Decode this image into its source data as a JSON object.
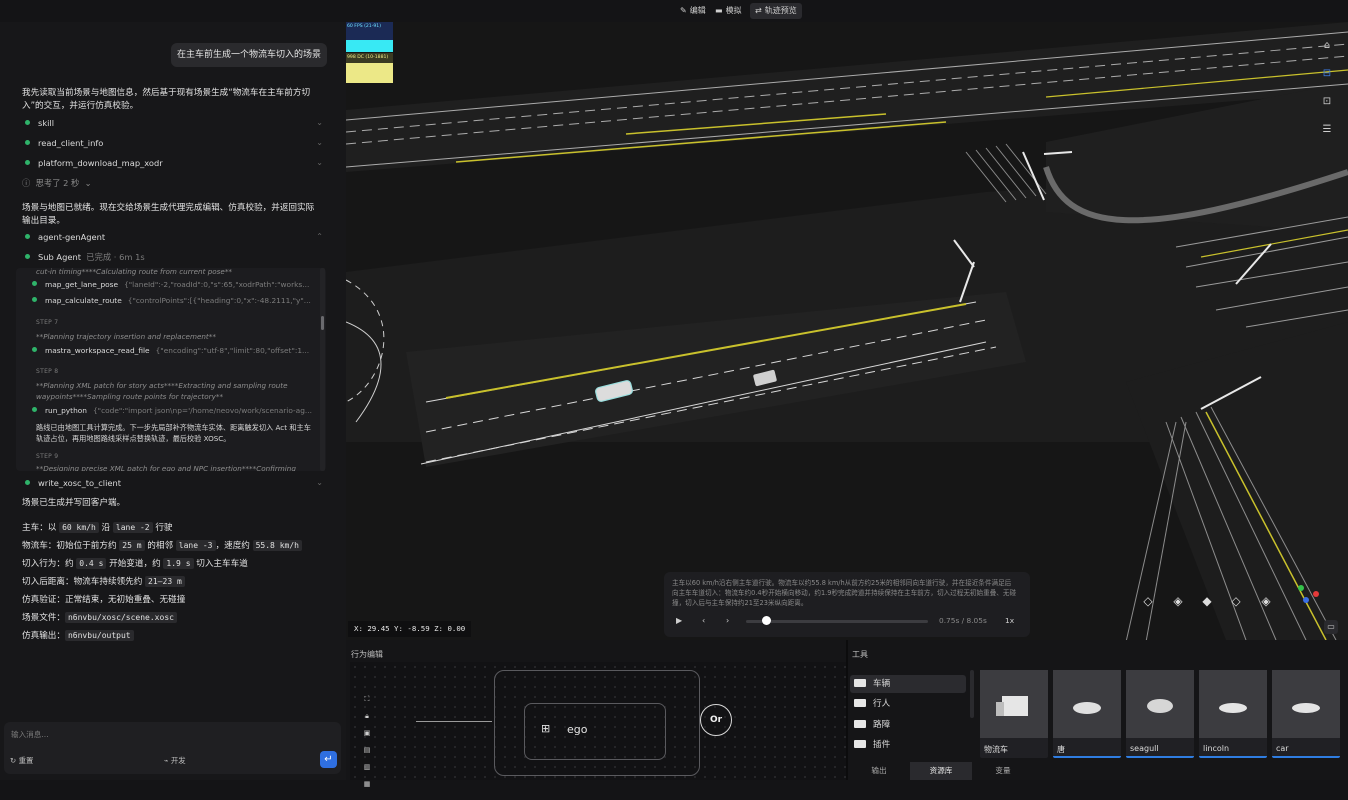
{
  "toolbar": {
    "items": [
      {
        "label": "编辑",
        "icon": "pencil-icon"
      },
      {
        "label": "模拟",
        "icon": "car-icon"
      },
      {
        "label": "轨迹预览",
        "icon": "trajectory-icon"
      }
    ]
  },
  "chat": {
    "user_message": "在主车前生成一个物流车切入的场景",
    "intro": "我先读取当前场景与地图信息，然后基于现有场景生成“物流车在主车前方切入”的交互，并运行仿真校验。",
    "tools_1": [
      "skill",
      "read_client_info",
      "platform_download_map_xodr"
    ],
    "thought": "思考了 2 秒",
    "ready_text": "场景与地图已就绪。现在交给场景生成代理完成编辑、仿真校验，并返回实际输出目录。",
    "agent_label": "agent-genAgent",
    "sub_agent": {
      "label": "Sub Agent",
      "status": "已完成 · 6m 1s"
    },
    "sub_panel": {
      "top_snippet": "cut-in timing****Calculating route from current pose**",
      "calls_1": [
        {
          "name": "map_get_lane_pose",
          "args": "{\"laneId\":-2,\"roadId\":0,\"s\":65,\"xodrPath\":\"works..."
        },
        {
          "name": "map_calculate_route",
          "args": "{\"controlPoints\":[{\"heading\":0,\"x\":-48.2111,\"y\"..."
        }
      ],
      "step7": "STEP 7",
      "step7_text": "**Planning trajectory insertion and replacement**",
      "call_7": {
        "name": "mastra_workspace_read_file",
        "args": "{\"encoding\":\"utf-8\",\"limit\":80,\"offset\":1..."
      },
      "step8": "STEP 8",
      "step8_text": "**Planning XML patch for story acts****Extracting and sampling route waypoints****Sampling route points for trajectory**",
      "call_8": {
        "name": "run_python",
        "args": "{\"code\":\"import json\\np='/home/neovo/work/scenario-ag..."
      },
      "note": "路线已由地图工具计算完成。下一步先局部补齐物流车实体、距离触发切入 Act 和主车轨迹占位，再用地图路线采样点替换轨迹，最后校验 XOSC。",
      "step9": "STEP 9",
      "step9_text": "**Designing precise XML patch for ego and NPC insertion****Confirming lane"
    },
    "write_tool": "write_xosc_to_client",
    "written": "场景已生成并写回客户端。",
    "summary": [
      {
        "label": "主车：以 ",
        "parts": [
          {
            "code": "60 km/h"
          },
          {
            "text": " 沿 "
          },
          {
            "code": "lane -2"
          },
          {
            "text": " 行驶"
          }
        ]
      },
      {
        "label": "物流车：初始位于前方约 ",
        "parts": [
          {
            "code": "25 m"
          },
          {
            "text": " 的相邻 "
          },
          {
            "code": "lane -3"
          },
          {
            "text": "，速度约 "
          },
          {
            "code": "55.8 km/h"
          }
        ]
      },
      {
        "label": "切入行为：约 ",
        "parts": [
          {
            "code": "0.4 s"
          },
          {
            "text": " 开始变道，约 "
          },
          {
            "code": "1.9 s"
          },
          {
            "text": " 切入主车车道"
          }
        ]
      },
      {
        "label": "切入后距离：物流车持续领先约 ",
        "parts": [
          {
            "code": "21–23 m"
          }
        ]
      },
      {
        "label": "仿真验证：正常结束，无初始重叠、无碰撞",
        "parts": []
      },
      {
        "label": "场景文件：",
        "parts": [
          {
            "code": "n6nvbu/xosc/scene.xosc"
          }
        ]
      },
      {
        "label": "仿真输出：",
        "parts": [
          {
            "code": "n6nvbu/output"
          }
        ]
      }
    ],
    "input_placeholder": "输入消息...",
    "reset_label": "重置",
    "mode_label": "开发"
  },
  "viewport": {
    "fps_label": "60 FPS (21-91)",
    "dc_label": "998 DC (10-1881)",
    "coords": "X: 29.45 Y: -8.59 Z: 0.00",
    "player": {
      "description": "主车以60 km/h沿右侧主车道行驶。物流车以约55.8 km/h从前方约25米的相邻同向车道行驶，并在接近条件满足后向主车车道切入：物流车约0.4秒开始横向移动，约1.9秒完成跨道并持续保持在主车前方，切入过程无初始重叠、无碰撞，切入后与主车保持约21至23米纵向距离。",
      "time": "0.75s / 8.05s",
      "speed": "1x",
      "progress": 0.09
    }
  },
  "behavior": {
    "title": "行为编辑",
    "node_label": "ego",
    "or_label": "Or"
  },
  "tools_panel": {
    "title": "工具",
    "folders": [
      "车辆",
      "行人",
      "路障",
      "插件"
    ],
    "assets": [
      "物流车",
      "唐",
      "seagull",
      "lincoln",
      "car"
    ],
    "tabs": [
      "输出",
      "资源库",
      "变量"
    ]
  },
  "colors": {
    "accent": "#2f7de1",
    "success": "#2fb36a",
    "fps_cyan": "#38e9f4",
    "dc_yellow": "#ece887",
    "lane_yellow": "#c9c12c"
  }
}
